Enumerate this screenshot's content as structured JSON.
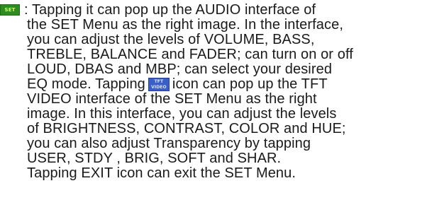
{
  "icons": {
    "set_icon": {
      "name": "set-icon",
      "label": "SET",
      "color": "#2e8b1f"
    },
    "tft_icon": {
      "name": "tft-video-icon",
      "label_top": "TFT",
      "label_bottom": "VIDEO",
      "color": "#3a5fc8"
    }
  },
  "paragraph": {
    "line1": ": Tapping it can pop up the AUDIO interface of",
    "line2": "the SET Menu as the right image. In the interface,",
    "line3": "you can adjust the levels of VOLUME, BASS,",
    "line4": "TREBLE, BALANCE and FADER; can turn on or off",
    "line5": "LOUD, DBAS and MBP;  can select your desired",
    "line6_before": "EQ mode.  Tapping",
    "line6_after": "icon can pop up the TFT",
    "line7": "VIDEO interface of the SET Menu as the right",
    "line8": "image. In this interface, you can adjust the levels",
    "line9": "of BRIGHTNESS, CONTRAST, COLOR and HUE;",
    "line10": "you can also adjust  Transparency by tapping",
    "line11": "USER, STDY , BRIG, SOFT and SHAR.",
    "line12": "Tapping EXIT icon can exit the SET Menu."
  }
}
